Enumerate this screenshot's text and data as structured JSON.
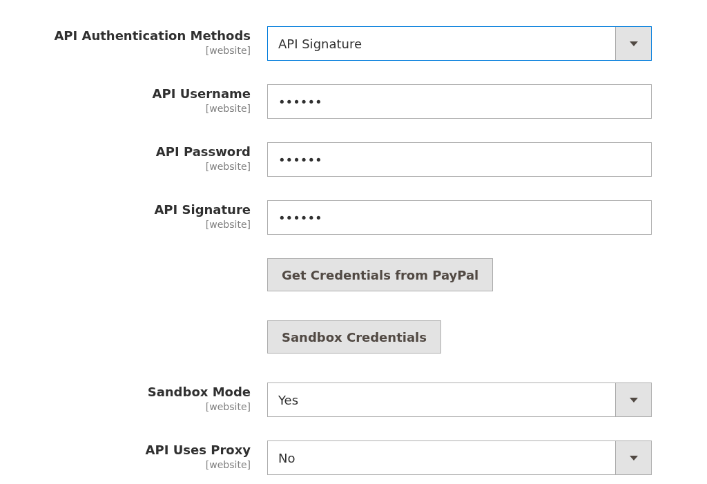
{
  "rows": [
    {
      "kind": "select",
      "label": "API Authentication Methods",
      "scope": "[website]",
      "value": "API Signature",
      "focused": true
    },
    {
      "kind": "password",
      "label": "API Username",
      "scope": "[website]",
      "value": "••••••"
    },
    {
      "kind": "password",
      "label": "API Password",
      "scope": "[website]",
      "value": "••••••"
    },
    {
      "kind": "password",
      "label": "API Signature",
      "scope": "[website]",
      "value": "••••••"
    },
    {
      "kind": "button",
      "value": "Get Credentials from PayPal"
    },
    {
      "kind": "button",
      "value": "Sandbox Credentials"
    },
    {
      "kind": "select",
      "label": "Sandbox Mode",
      "scope": "[website]",
      "value": "Yes",
      "focused": false
    },
    {
      "kind": "select",
      "label": "API Uses Proxy",
      "scope": "[website]",
      "value": "No",
      "focused": false
    }
  ]
}
